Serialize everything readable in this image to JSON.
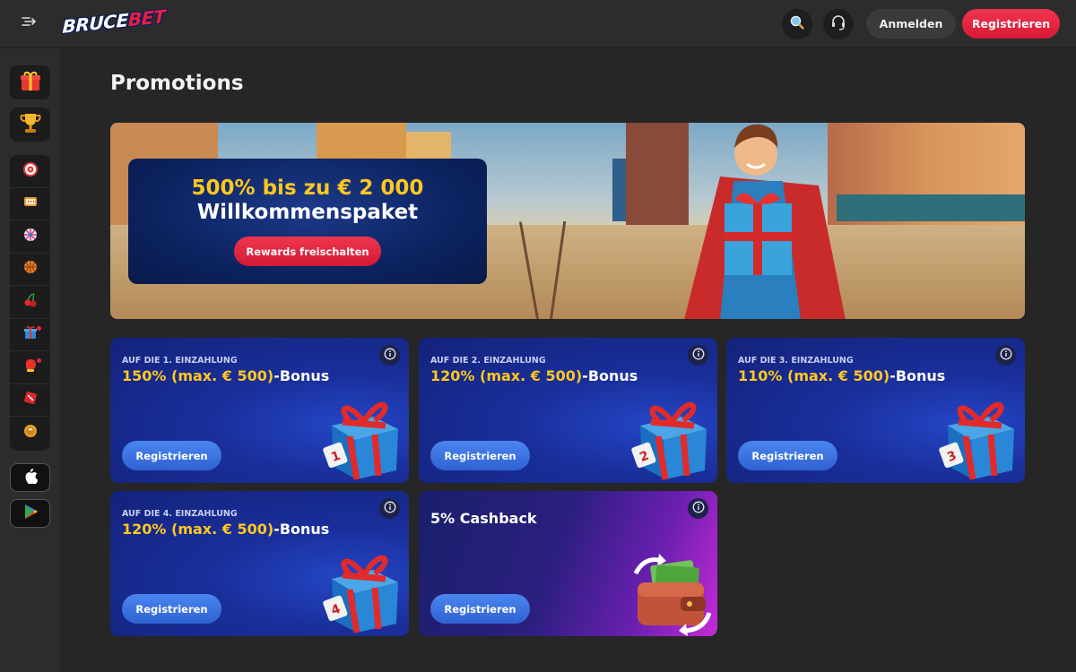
{
  "header": {
    "menu_icon": "expand-menu-icon",
    "logo": "BRUCEBET",
    "search_icon": "search-icon",
    "support_icon": "headset-icon",
    "login_label": "Anmelden",
    "register_label": "Registrieren"
  },
  "sidebar": {
    "top_items": [
      "gift-icon",
      "trophy-icon"
    ],
    "items": [
      {
        "icon": "target-icon",
        "dot": false
      },
      {
        "icon": "slot-icon",
        "dot": false
      },
      {
        "icon": "wheel-icon",
        "dot": false
      },
      {
        "icon": "basketball-icon",
        "dot": false
      },
      {
        "icon": "cherry-icon",
        "dot": false
      },
      {
        "icon": "gift-box-icon",
        "dot": true
      },
      {
        "icon": "boxing-glove-icon",
        "dot": true
      },
      {
        "icon": "dice-icon",
        "dot": false
      },
      {
        "icon": "coin-icon",
        "dot": false
      }
    ],
    "apps": [
      "apple-icon",
      "google-play-icon"
    ]
  },
  "main": {
    "title": "Promotions",
    "hero": {
      "line1": "500% bis zu € 2 000",
      "line2": "Willkommenspaket",
      "button": "Rewards freischalten"
    },
    "cards": [
      {
        "kicker": "AUF DIE 1. EINZAHLUNG",
        "title_highlight": "150% (max. € 500)",
        "title_rest": "-Bonus",
        "button": "Registrieren",
        "badge": "1"
      },
      {
        "kicker": "AUF DIE 2. EINZAHLUNG",
        "title_highlight": "120% (max. € 500)",
        "title_rest": "-Bonus",
        "button": "Registrieren",
        "badge": "2"
      },
      {
        "kicker": "AUF DIE 3. EINZAHLUNG",
        "title_highlight": "110% (max. € 500)",
        "title_rest": "-Bonus",
        "button": "Registrieren",
        "badge": "3"
      },
      {
        "kicker": "AUF DIE 4. EINZAHLUNG",
        "title_highlight": "120% (max. € 500)",
        "title_rest": "-Bonus",
        "button": "Registrieren",
        "badge": "4"
      }
    ],
    "cashback": {
      "title": "5% Cashback",
      "button": "Registrieren"
    }
  },
  "colors": {
    "accent_red": "#e8203f",
    "highlight_yellow": "#ffc81e",
    "card_blue": "#1a2f9c",
    "button_blue": "#3a72e0"
  }
}
